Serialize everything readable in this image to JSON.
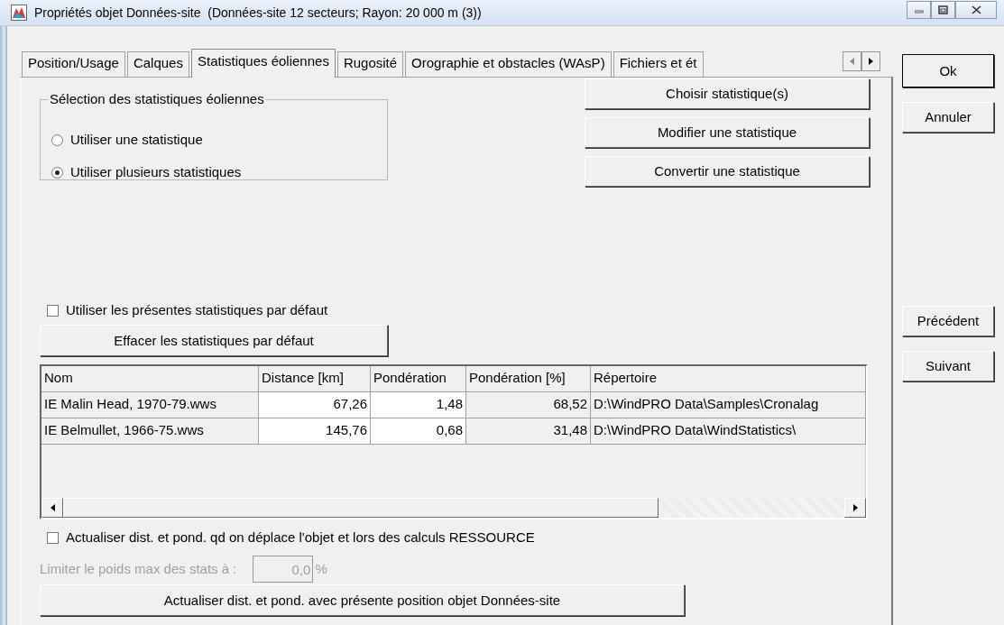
{
  "window": {
    "title": "Propriétés objet Données-site  (Données-site 12 secteurs; Rayon: 20 000 m (3))"
  },
  "tabs": [
    {
      "label": "Position/Usage",
      "selected": false
    },
    {
      "label": "Calques",
      "selected": false
    },
    {
      "label": "Statistiques éoliennes",
      "selected": true
    },
    {
      "label": "Rugosité",
      "selected": false
    },
    {
      "label": "Orographie et obstacles (WAsP)",
      "selected": false
    },
    {
      "label": "Fichiers et ét",
      "selected": false
    }
  ],
  "selection_group": {
    "title": "Sélection des statistiques éoliennes",
    "options": [
      {
        "label": "Utiliser une statistique",
        "selected": false
      },
      {
        "label": "Utiliser plusieurs statistiques",
        "selected": true
      }
    ]
  },
  "action_buttons": [
    "Choisir statistique(s)",
    "Modifier une statistique",
    "Convertir une statistique"
  ],
  "default_checkbox": {
    "label": "Utiliser les présentes statistiques par défaut",
    "checked": false
  },
  "clear_button": "Effacer les statistiques par défaut",
  "table": {
    "columns": [
      {
        "label": "Nom",
        "editable": false
      },
      {
        "label": "Distance [km]",
        "editable": true
      },
      {
        "label": "Pondération",
        "editable": true
      },
      {
        "label": "Pondération [%]",
        "editable": false
      },
      {
        "label": "Répertoire",
        "editable": false
      }
    ],
    "rows": [
      [
        "IE Malin Head, 1970-79.wws",
        "67,26",
        "1,48",
        "68,52",
        "D:\\WindPRO Data\\Samples\\Cronalag"
      ],
      [
        "IE Belmullet, 1966-75.wws",
        "145,76",
        "0,68",
        "31,48",
        "D:\\WindPRO Data\\WindStatistics\\"
      ]
    ]
  },
  "update_checkbox": {
    "label": "Actualiser dist. et pond. qd on déplace l'objet et lors des calculs RESSOURCE",
    "checked": false
  },
  "limit": {
    "label": "Limiter le poids max des stats à :",
    "value": "0,0",
    "unit": "%",
    "disabled": true
  },
  "update_button": "Actualiser dist. et pond. avec présente position objet Données-site",
  "side_buttons": [
    {
      "label": "Ok",
      "kind": "default"
    },
    {
      "label": "Annuler",
      "kind": "normal"
    },
    {
      "label": "Précédent",
      "kind": "spaced"
    },
    {
      "label": "Suivant",
      "kind": "normal"
    }
  ]
}
